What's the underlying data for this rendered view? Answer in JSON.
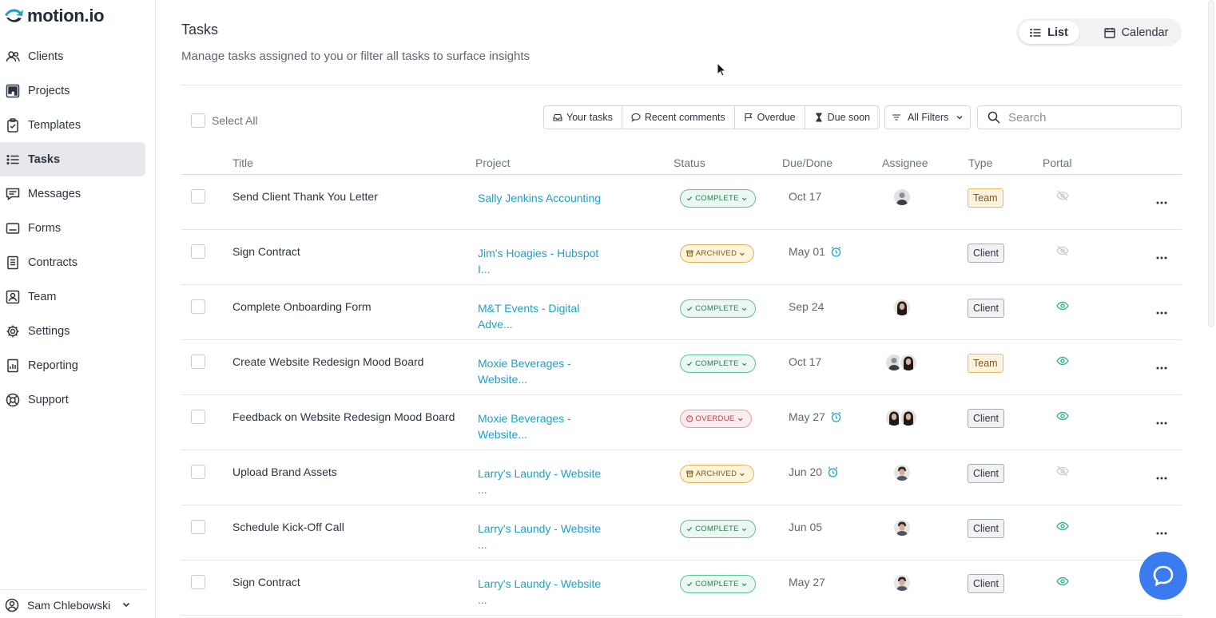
{
  "app": {
    "logo_text": "motion.io"
  },
  "sidebar": {
    "items": [
      {
        "label": "Clients",
        "icon": "users-icon"
      },
      {
        "label": "Projects",
        "icon": "kanban-icon"
      },
      {
        "label": "Templates",
        "icon": "clipboard-check-icon"
      },
      {
        "label": "Tasks",
        "icon": "list-icon",
        "active": true
      },
      {
        "label": "Messages",
        "icon": "message-icon"
      },
      {
        "label": "Forms",
        "icon": "form-icon"
      },
      {
        "label": "Contracts",
        "icon": "document-icon"
      },
      {
        "label": "Team",
        "icon": "id-badge-icon"
      },
      {
        "label": "Settings",
        "icon": "gear-icon"
      },
      {
        "label": "Reporting",
        "icon": "report-icon"
      },
      {
        "label": "Support",
        "icon": "lifebuoy-icon"
      }
    ],
    "user": {
      "name": "Sam Chlebowski"
    }
  },
  "header": {
    "title": "Tasks",
    "subtitle": "Manage tasks assigned to you or filter all tasks to surface insights",
    "view_list": "List",
    "view_calendar": "Calendar"
  },
  "toolbar": {
    "select_all": "Select All",
    "filters": [
      "Your tasks",
      "Recent comments",
      "Overdue",
      "Due soon"
    ],
    "all_filters": "All Filters",
    "search_placeholder": "Search"
  },
  "table": {
    "columns": [
      "Title",
      "Project",
      "Status",
      "Due/Done",
      "Assignee",
      "Type",
      "Portal"
    ],
    "rows": [
      {
        "title": "Send Client Thank You Letter",
        "project": "Sally Jenkins Accounting",
        "status": "COMPLETE",
        "due": "Oct 17",
        "alarm": false,
        "type": "Team",
        "portal_visible": false
      },
      {
        "title": "Sign Contract",
        "project": "Jim's Hoagies - Hubspot I...",
        "status": "ARCHIVED",
        "due": "May 01",
        "alarm": true,
        "type": "Client",
        "portal_visible": false
      },
      {
        "title": "Complete Onboarding Form",
        "project": "M&T Events - Digital Adve...",
        "status": "COMPLETE",
        "due": "Sep 24",
        "alarm": false,
        "type": "Client",
        "portal_visible": true
      },
      {
        "title": "Create Website Redesign Mood Board",
        "project": "Moxie Beverages - Website...",
        "status": "COMPLETE",
        "due": "Oct 17",
        "alarm": false,
        "type": "Team",
        "portal_visible": true
      },
      {
        "title": "Feedback on Website Redesign Mood Board",
        "project": "Moxie Beverages - Website...",
        "status": "OVERDUE",
        "due": "May 27",
        "alarm": true,
        "type": "Client",
        "portal_visible": true
      },
      {
        "title": "Upload Brand Assets",
        "project": "Larry's Laundy - Website ...",
        "status": "ARCHIVED",
        "due": "Jun 20",
        "alarm": true,
        "type": "Client",
        "portal_visible": false
      },
      {
        "title": "Schedule Kick-Off Call",
        "project": "Larry's Laundy - Website ...",
        "status": "COMPLETE",
        "due": "Jun 05",
        "alarm": false,
        "type": "Client",
        "portal_visible": true
      },
      {
        "title": "Sign Contract",
        "project": "Larry's Laundy - Website ...",
        "status": "COMPLETE",
        "due": "May 27",
        "alarm": false,
        "type": "Client",
        "portal_visible": true
      }
    ]
  },
  "colors": {
    "link": "#1e9fc8",
    "chat": "#3a7bf0",
    "complete": "#5bc292",
    "archived": "#e2b451",
    "overdue": "#e89aa3"
  }
}
